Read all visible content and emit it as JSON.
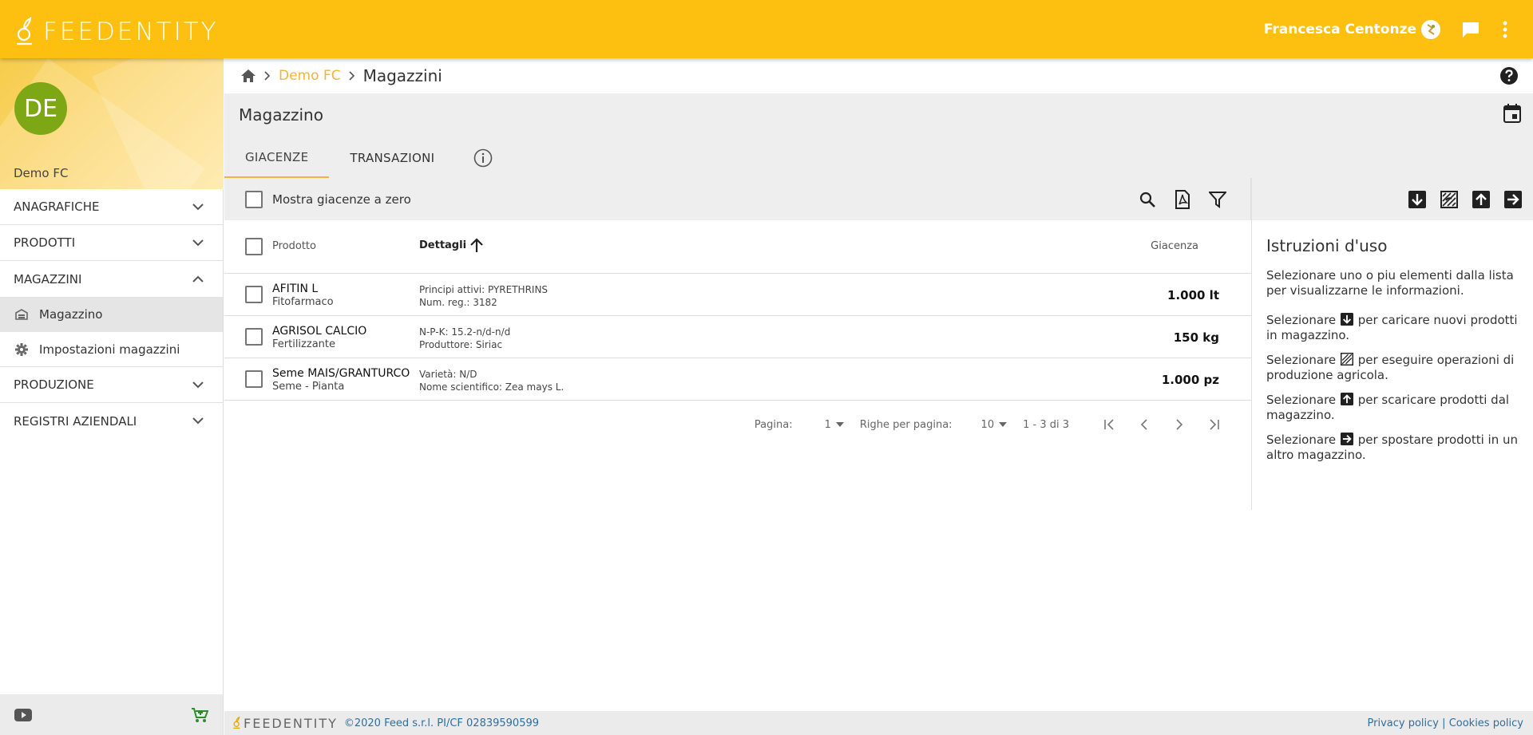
{
  "topbar": {
    "logo_text": "FEEDENTITY",
    "user_name": "Francesca Centonze"
  },
  "sidebar": {
    "avatar_initials": "DE",
    "company": "Demo FC",
    "sections": [
      {
        "label": "ANAGRAFICHE"
      },
      {
        "label": "PRODOTTI"
      },
      {
        "label": "MAGAZZINI"
      },
      {
        "label": "PRODUZIONE"
      },
      {
        "label": "REGISTRI AZIENDALI"
      }
    ],
    "subitems": [
      {
        "label": "Magazzino"
      },
      {
        "label": "Impostazioni magazzini"
      }
    ]
  },
  "breadcrumb": {
    "link": "Demo FC",
    "current": "Magazzini"
  },
  "page": {
    "title": "Magazzino",
    "tabs": [
      "GIACENZE",
      "TRANSAZIONI"
    ]
  },
  "toolbar": {
    "show_zero_label": "Mostra giacenze a zero"
  },
  "table": {
    "headers": {
      "product": "Prodotto",
      "details": "Dettagli",
      "stock": "Giacenza"
    },
    "rows": [
      {
        "name": "AFITIN L",
        "type": "Fitofarmaco",
        "detail1": "Principi attivi: PYRETHRINS",
        "detail2": "Num. reg.: 3182",
        "stock": "1.000 lt"
      },
      {
        "name": "AGRISOL CALCIO",
        "type": "Fertilizzante",
        "detail1": "N-P-K: 15.2-n/d-n/d",
        "detail2": "Produttore: Siriac",
        "stock": "150 kg"
      },
      {
        "name": "Seme MAIS/GRANTURCO",
        "type": "Seme - Pianta",
        "detail1": "Varietà: N/D",
        "detail2": "Nome scientifico: Zea mays L.",
        "stock": "1.000 pz"
      }
    ]
  },
  "pager": {
    "page_label": "Pagina:",
    "page_value": "1",
    "rows_label": "Righe per pagina:",
    "rows_value": "10",
    "range": "1 - 3 di 3"
  },
  "info": {
    "title": "Istruzioni d'uso",
    "p1": "Selezionare uno o piu elementi dalla lista per visualizzarne le informazioni.",
    "select_word": "Selezionare",
    "p2_rest": "per caricare nuovi prodotti in magazzino.",
    "p3_rest": "per eseguire operazioni di produzione agricola.",
    "p4_rest": "per scaricare prodotti dal magazzino.",
    "p5_rest": "per spostare prodotti in un altro magazzino."
  },
  "footer": {
    "logo": "FEEDENTITY",
    "copyright": "©2020 Feed s.r.l. PI/CF 02839590599",
    "privacy": "Privacy policy",
    "separator": "|",
    "cookies": "Cookies policy"
  },
  "colors": {
    "brand": "#FDC010",
    "accent": "#F3B43A",
    "avatar": "#7DA715",
    "link": "#2E6E9E"
  },
  "icons": [
    "home-icon",
    "help-icon",
    "calendar-icon",
    "info-icon",
    "search-icon",
    "pdf-icon",
    "filter-icon",
    "load-icon",
    "production-icon",
    "unload-icon",
    "move-icon",
    "chat-icon",
    "more-vert-icon",
    "youtube-icon",
    "cart-icon",
    "warehouse-icon",
    "gear-icon"
  ]
}
